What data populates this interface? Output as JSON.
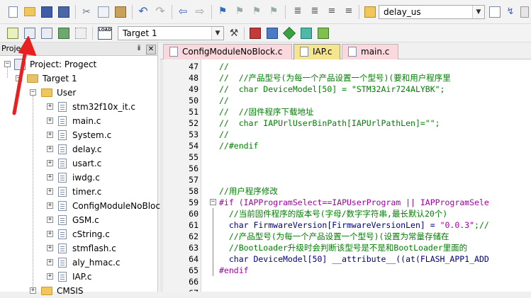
{
  "toolbar1": {
    "target_combo_value": "delay_us",
    "icons": [
      "new-file-icon",
      "open-folder-icon",
      "save-icon",
      "save-all-icon",
      "cut-icon",
      "copy-icon",
      "paste-icon",
      "undo-icon",
      "redo-icon",
      "nav-back-icon",
      "nav-forward-icon",
      "bookmark-icon",
      "bookmark-prev-icon",
      "bookmark-next-icon",
      "bookmark-clear-icon",
      "indent-icon",
      "unindent-icon",
      "comment-icon",
      "uncomment-icon",
      "find-in-files-icon"
    ]
  },
  "toolbar2": {
    "target_select_value": "Target 1",
    "load_label": "LOAD"
  },
  "project_panel": {
    "title": "Project",
    "pin": "ⅱ",
    "close": "✕",
    "root": "Project: Progect",
    "target": "Target 1",
    "group": "User",
    "files": [
      "stm32f10x_it.c",
      "main.c",
      "System.c",
      "delay.c",
      "usart.c",
      "iwdg.c",
      "timer.c",
      "ConfigModuleNoBloc",
      "GSM.c",
      "cString.c",
      "stmflash.c",
      "aly_hmac.c",
      "IAP.c"
    ],
    "next_group": "CMSIS"
  },
  "tabs": [
    {
      "label": "ConfigModuleNoBlock.c",
      "active": false
    },
    {
      "label": "IAP.c",
      "active": true
    },
    {
      "label": "main.c",
      "active": false
    }
  ],
  "editor": {
    "lines": [
      {
        "n": "47",
        "t": "//",
        "k": "com"
      },
      {
        "n": "48",
        "t": "//  //产品型号(为每一个产品设置一个型号)(要和用户程序里",
        "k": "com"
      },
      {
        "n": "49",
        "t": "//  char DeviceModel[50] = \"STM32Air724ALYBK\";",
        "k": "com"
      },
      {
        "n": "50",
        "t": "//",
        "k": "com"
      },
      {
        "n": "51",
        "t": "//  //固件程序下载地址",
        "k": "com"
      },
      {
        "n": "52",
        "t": "//  char IAPUrlUserBinPath[IAPUrlPathLen]=\"\";",
        "k": "com"
      },
      {
        "n": "53",
        "t": "//",
        "k": "com"
      },
      {
        "n": "54",
        "t": "//#endif",
        "k": "com"
      },
      {
        "n": "55",
        "t": "",
        "k": "com"
      },
      {
        "n": "56",
        "t": "",
        "k": "com"
      },
      {
        "n": "57",
        "t": "",
        "k": "com"
      },
      {
        "n": "58",
        "t": "//用户程序修改",
        "k": "com"
      },
      {
        "n": "59",
        "t": "#if (IAPProgramSelect==IAPUserProgram || IAPProgramSele",
        "k": "pre"
      },
      {
        "n": "60",
        "t": "  //当前固件程序的版本号(字母/数字字符串,最长默认20个)",
        "k": "com"
      },
      {
        "n": "61",
        "t": "  char FirmwareVersion[FirmwareVersionLen] = \"0.0.3\";//",
        "k": "mix61"
      },
      {
        "n": "62",
        "t": "  //产品型号(为每一个产品设置一个型号)(设置为常量存储在",
        "k": "com"
      },
      {
        "n": "63",
        "t": "  //BootLoader升级时会判断该型号是不是和BootLoader里面的",
        "k": "com"
      },
      {
        "n": "64",
        "t": "  char DeviceModel[50] __attribute__((at(FLASH_APP1_ADD",
        "k": "txt"
      },
      {
        "n": "65",
        "t": "#endif",
        "k": "pre"
      },
      {
        "n": "66",
        "t": "",
        "k": "com"
      },
      {
        "n": "67",
        "t": "",
        "k": "com"
      }
    ],
    "line61_code": "  char FirmwareVersion[FirmwareVersionLen] = ",
    "line61_str": "\"0.0.3\"",
    "line61_tail": ";//"
  },
  "colors": {
    "comment": "#008000",
    "preprocessor": "#a000a0",
    "code": "#000080",
    "arrow": "#e8201f",
    "active_tab": "#f6e58f",
    "inactive_tab": "#fbd7de"
  }
}
